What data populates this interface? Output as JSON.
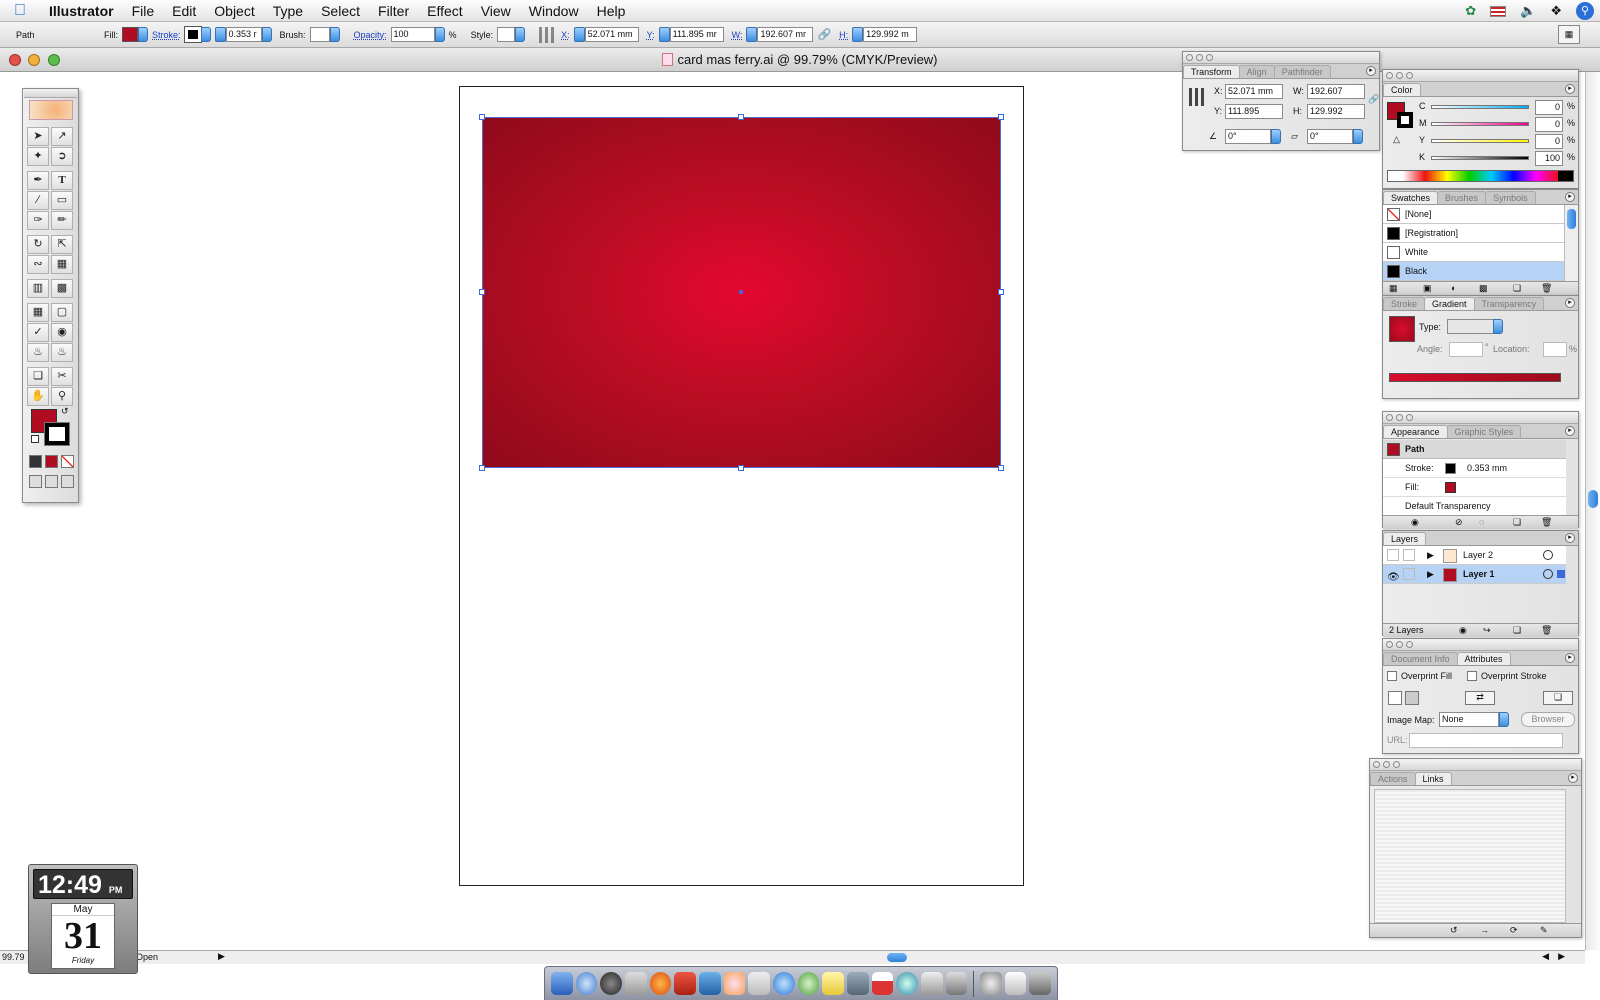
{
  "menubar": {
    "app": "Illustrator",
    "items": [
      "File",
      "Edit",
      "Object",
      "Type",
      "Select",
      "Filter",
      "Effect",
      "View",
      "Window",
      "Help"
    ]
  },
  "options_bar": {
    "selection_type": "Path",
    "fill_label": "Fill:",
    "stroke_label": "Stroke:",
    "stroke_weight": "0.353 r",
    "brush_label": "Brush:",
    "opacity_label": "Opacity:",
    "opacity_value": "100",
    "percent": "%",
    "style_label": "Style:",
    "x_label": "X:",
    "x_value": "52.071 mm",
    "y_label": "Y:",
    "y_value": "111.895 mr",
    "w_label": "W:",
    "w_value": "192.607 mr",
    "h_label": "H:",
    "h_value": "129.992 m"
  },
  "document": {
    "title": "card mas ferry.ai @ 99.79% (CMYK/Preview)",
    "zoom": "99.79",
    "status": "Open"
  },
  "colors": {
    "accent_red": "#b10d22",
    "selection_blue": "#3f67d8",
    "highlight_row": "#b6d3f6"
  },
  "transform_panel": {
    "tabs": [
      "Transform",
      "Align",
      "Pathfinder"
    ],
    "x_label": "X:",
    "x": "52.071 mm",
    "y_label": "Y:",
    "y": "111.895",
    "w_label": "W:",
    "w": "192.607",
    "h_label": "H:",
    "h": "129.992",
    "rotate": "0°",
    "shear": "0°"
  },
  "color_panel": {
    "title": "Color",
    "channels": [
      {
        "label": "C",
        "value": "0"
      },
      {
        "label": "M",
        "value": "0"
      },
      {
        "label": "Y",
        "value": "0"
      },
      {
        "label": "K",
        "value": "100"
      }
    ],
    "percent": "%"
  },
  "swatches_panel": {
    "tabs": [
      "Swatches",
      "Brushes",
      "Symbols"
    ],
    "items": [
      {
        "name": "[None]",
        "color": "#ffffff"
      },
      {
        "name": "[Registration]",
        "color": "#000000"
      },
      {
        "name": "White",
        "color": "#ffffff"
      },
      {
        "name": "Black",
        "color": "#000000"
      }
    ]
  },
  "gradient_panel": {
    "tabs": [
      "Stroke",
      "Gradient",
      "Transparency"
    ],
    "type_label": "Type:",
    "angle_label": "Angle:",
    "degree": "°",
    "location_label": "Location:",
    "percent": "%"
  },
  "appearance_panel": {
    "tabs": [
      "Appearance",
      "Graphic Styles"
    ],
    "object": "Path",
    "stroke_label": "Stroke:",
    "stroke_value": "0.353 mm",
    "fill_label": "Fill:",
    "transparency": "Default Transparency"
  },
  "layers_panel": {
    "tab": "Layers",
    "layers": [
      {
        "name": "Layer 2"
      },
      {
        "name": "Layer 1"
      }
    ],
    "count": "2 Layers"
  },
  "attributes_panel": {
    "tabs": [
      "Document Info",
      "Attributes"
    ],
    "overprint_fill": "Overprint Fill",
    "overprint_stroke": "Overprint Stroke",
    "image_map_label": "Image Map:",
    "image_map_value": "None",
    "browser_button": "Browser",
    "url_label": "URL:"
  },
  "actions_panel": {
    "tabs": [
      "Actions",
      "Links"
    ]
  },
  "clock_widget": {
    "time": "12:49",
    "ampm": "PM",
    "month": "May",
    "day": "31",
    "weekday": "Friday"
  }
}
